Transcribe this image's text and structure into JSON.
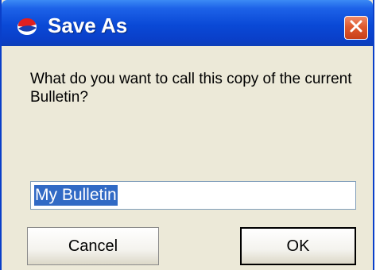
{
  "window": {
    "title": "Save As",
    "title_icon": "app-logo-icon",
    "close_icon": "close-icon"
  },
  "prompt": {
    "text": "What do you want to call this copy of the current Bulletin?"
  },
  "name_field": {
    "value": "My Bulletin",
    "selected": true
  },
  "buttons": {
    "cancel_label": "Cancel",
    "ok_label": "OK"
  },
  "colors": {
    "titlebar": "#0a49d6",
    "dialog_bg": "#ece9d8",
    "close_button": "#e05a2e",
    "selection": "#316ac5"
  }
}
